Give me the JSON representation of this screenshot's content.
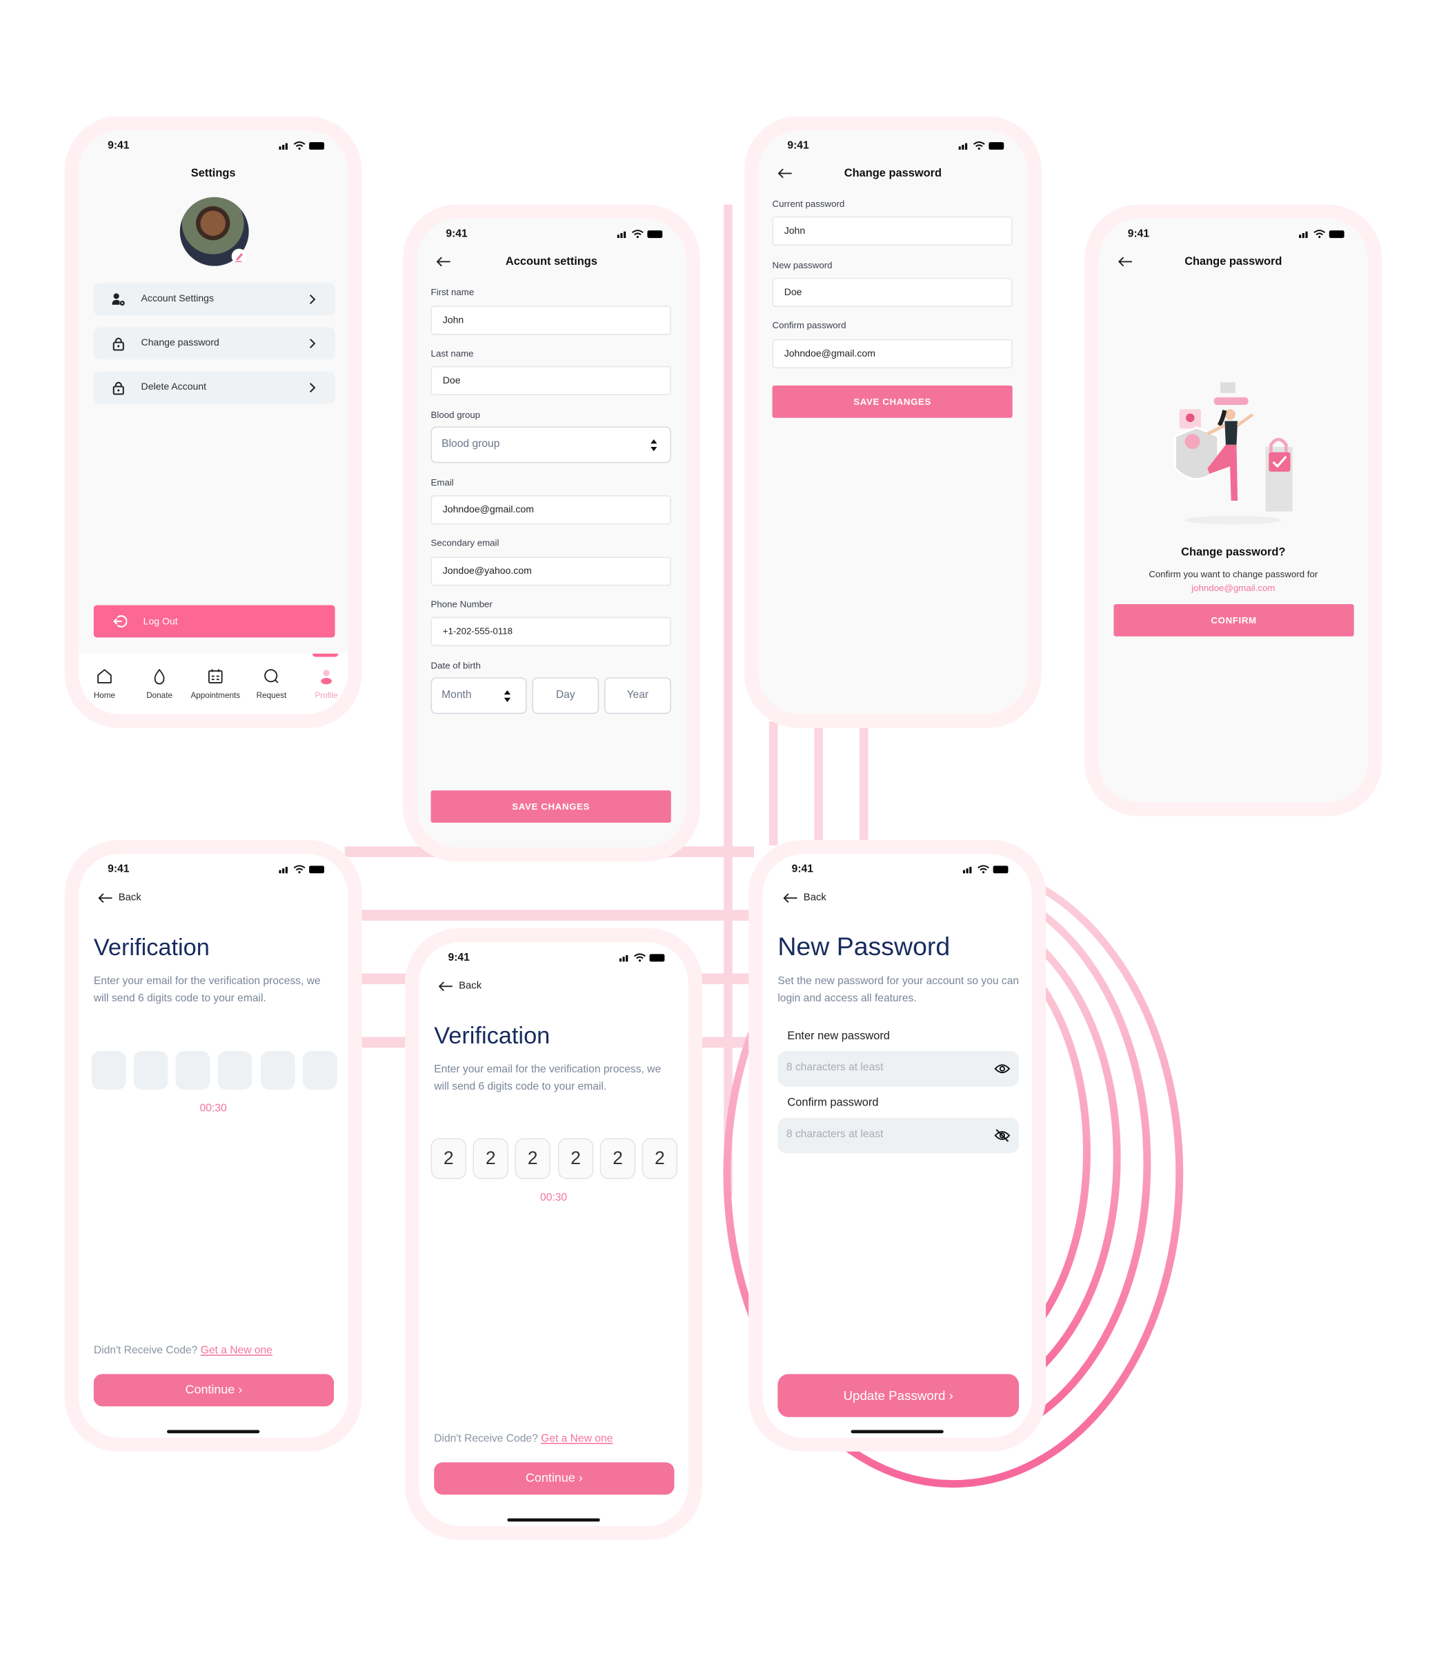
{
  "status_bar": {
    "time": "9:41"
  },
  "colors": {
    "accent": "#f4739b",
    "logout": "#fd6794",
    "heading_navy": "#172b5e",
    "frame": "#fff1f3",
    "input_bg": "#eef1f4"
  },
  "settings_screen": {
    "title": "Settings",
    "avatar_edit_icon": "pencil-icon",
    "menu": [
      {
        "label": "Account Settings",
        "icon": "user-gear-icon"
      },
      {
        "label": "Change password",
        "icon": "lock-icon"
      },
      {
        "label": "Delete Account",
        "icon": "lock-icon"
      }
    ],
    "logout_label": "Log Out",
    "nav": [
      {
        "label": "Home",
        "icon": "home-icon",
        "active": false
      },
      {
        "label": "Donate",
        "icon": "drop-icon",
        "active": false
      },
      {
        "label": "Appointments",
        "icon": "calendar-icon",
        "active": false
      },
      {
        "label": "Request",
        "icon": "search-icon",
        "active": false
      },
      {
        "label": "Profile",
        "icon": "profile-icon",
        "active": true
      }
    ]
  },
  "account_settings": {
    "title": "Account settings",
    "first_name": {
      "label": "First name",
      "value": "John"
    },
    "last_name": {
      "label": "Last name",
      "value": "Doe"
    },
    "blood_group": {
      "label": "Blood group",
      "placeholder": "Blood group"
    },
    "email": {
      "label": "Email",
      "value": "Johndoe@gmail.com"
    },
    "secondary_email": {
      "label": "Secondary email",
      "value": "Jondoe@yahoo.com"
    },
    "phone": {
      "label": "Phone Number",
      "value": "+1-202-555-0118"
    },
    "dob": {
      "label": "Date of birth",
      "month": "Month",
      "day": "Day",
      "year": "Year"
    },
    "save_label": "SAVE CHANGES"
  },
  "change_password": {
    "title": "Change password",
    "current": {
      "label": "Current password",
      "value": "John"
    },
    "new": {
      "label": "New password",
      "value": "Doe"
    },
    "confirm": {
      "label": "Confirm password",
      "value": "Johndoe@gmail.com"
    },
    "save_label": "SAVE CHANGES"
  },
  "confirm_change": {
    "title": "Change password",
    "heading": "Change password?",
    "text": "Confirm you want to change password for",
    "email": "johndoe@gmail.com",
    "confirm_label": "CONFIRM"
  },
  "verification_empty": {
    "back_label": "Back",
    "title": "Verification",
    "description": "Enter your email for the verification process, we will send 6 digits code to your email.",
    "digits": [
      "",
      "",
      "",
      "",
      "",
      ""
    ],
    "timer": "00:30",
    "resend_text": "Didn't Receive Code?",
    "resend_link": "Get a New one",
    "continue_label": "Continue"
  },
  "verification_filled": {
    "back_label": "Back",
    "title": "Verification",
    "description": "Enter your email for the verification process, we will send 6 digits code to your email.",
    "digits": [
      "2",
      "2",
      "2",
      "2",
      "2",
      "2"
    ],
    "timer": "00:30",
    "resend_text": "Didn't Receive Code?",
    "resend_link": "Get a New one",
    "continue_label": "Continue"
  },
  "new_password": {
    "back_label": "Back",
    "title": "New Password",
    "description": "Set the new password for your account so you can login and access all features.",
    "new_label": "Enter new password",
    "new_placeholder": "8 characters at least",
    "confirm_label": "Confirm password",
    "confirm_placeholder": "8 characters at least",
    "update_label": "Update Password"
  }
}
